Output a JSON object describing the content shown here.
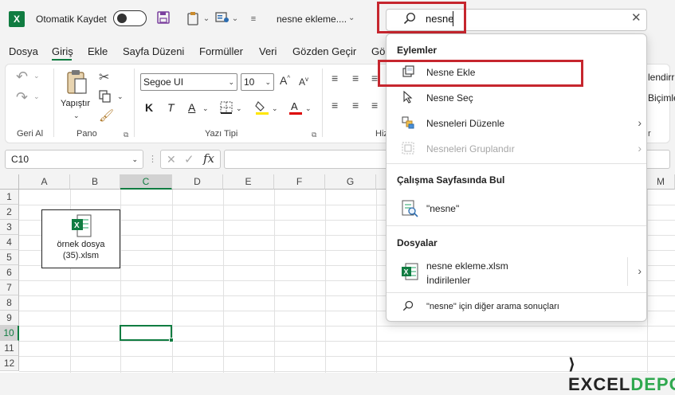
{
  "titlebar": {
    "app_icon": "X",
    "autosave_label": "Otomatik Kaydet",
    "document_title": "nesne ekleme....",
    "dropdown_arrow": "⌄"
  },
  "search": {
    "query": "nesne",
    "clear_symbol": "✕"
  },
  "tabs": [
    {
      "label": "Dosya"
    },
    {
      "label": "Giriş"
    },
    {
      "label": "Ekle"
    },
    {
      "label": "Sayfa Düzeni"
    },
    {
      "label": "Formüller"
    },
    {
      "label": "Veri"
    },
    {
      "label": "Gözden Geçir"
    },
    {
      "label": "Gö"
    }
  ],
  "ribbon": {
    "groups": {
      "undo": "Geri Al",
      "clipboard": "Pano",
      "font": "Yazı Tipi",
      "alignment": "Hiz"
    },
    "paste_label": "Yapıştır",
    "font_name": "Segoe UI",
    "font_size": "10",
    "bold": "K",
    "italic": "T",
    "underline": "A",
    "right_peek_1": "lendirr",
    "right_peek_2": "Biçimle",
    "right_peek_3": "r"
  },
  "formula_bar": {
    "name_box": "C10",
    "fx": "fx"
  },
  "grid": {
    "columns": [
      "A",
      "B",
      "C",
      "D",
      "E",
      "F",
      "G"
    ],
    "rows": [
      "1",
      "2",
      "3",
      "4",
      "5",
      "6",
      "7",
      "8",
      "9",
      "10",
      "11",
      "12"
    ],
    "right_column": "M"
  },
  "embedded_object": {
    "line1": "örnek dosya",
    "line2": "(35).xlsm"
  },
  "dropdown": {
    "actions_title": "Eylemler",
    "actions": [
      {
        "label": "Nesne Ekle"
      },
      {
        "label": "Nesne Seç"
      },
      {
        "label": "Nesneleri Düzenle"
      },
      {
        "label": "Nesneleri Gruplandır"
      }
    ],
    "find_title": "Çalışma Sayfasında Bul",
    "find_item": "\"nesne\"",
    "files_title": "Dosyalar",
    "file_name": "nesne ekleme.xlsm",
    "file_location": "İndirilenler",
    "more_results": "\"nesne\" için diğer arama sonuçları"
  },
  "watermark": {
    "part1": "EXCEL",
    "part2": "DEPO"
  },
  "colors": {
    "excel_green": "#107c41",
    "highlight_red": "#c6262e",
    "watermark_green": "#2fa84f"
  }
}
